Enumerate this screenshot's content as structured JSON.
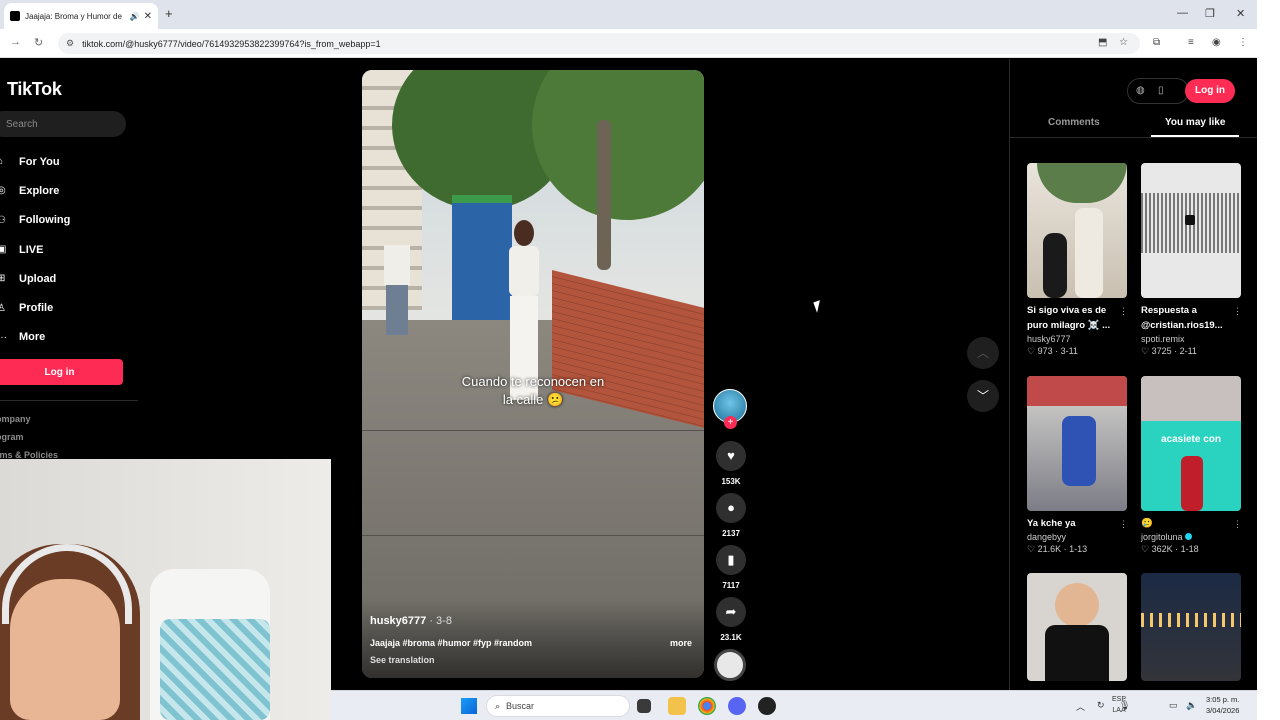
{
  "browser": {
    "tab_title": "Jaajaja: Broma y Humor de",
    "tab_close": "✕",
    "new_tab": "+",
    "url": "tiktok.com/@husky6777/video/7614932953822399764?is_from_webapp=1"
  },
  "sidebar": {
    "logo_text": "TikTok",
    "search_placeholder": "Search",
    "items": [
      {
        "label": "For You",
        "icon": "home-icon"
      },
      {
        "label": "Explore",
        "icon": "compass-icon"
      },
      {
        "label": "Following",
        "icon": "people-icon"
      },
      {
        "label": "LIVE",
        "icon": "live-icon"
      },
      {
        "label": "Upload",
        "icon": "upload-icon"
      },
      {
        "label": "Profile",
        "icon": "person-icon"
      },
      {
        "label": "More",
        "icon": "more-icon"
      }
    ],
    "login_label": "Log in",
    "footer_links": [
      "ompany",
      "ogram",
      "rms & Policies"
    ]
  },
  "video": {
    "caption_line1": "Cuando te reconocen en",
    "caption_line2": "la calle 😕",
    "username": "husky6777",
    "date": " · 3-8",
    "description": "Jaajaja #broma #humor #fyp #random",
    "more_label": "more",
    "see_translation": "See translation"
  },
  "actions": {
    "likes": "153K",
    "comments": "2137",
    "saves": "7117",
    "shares": "23.1K"
  },
  "right_panel": {
    "login_label": "Log in",
    "tab_comments": "Comments",
    "tab_you_may_like": "You may like",
    "cards": [
      {
        "title": "Si sigo viva es de puro milagro ☠️ ...",
        "user": "husky6777",
        "stats": "♡ 973 · 3-11"
      },
      {
        "title": "Respuesta a @cristian.rios19...",
        "user": "spoti.remix",
        "stats": "♡ 3725 · 2-11"
      },
      {
        "title": "Ya kche ya",
        "user": "dangebyy",
        "stats": "♡ 21.6K · 1-13"
      },
      {
        "title": "🥲",
        "user": "jorgitoluna",
        "stats": "♡ 362K · 1-18"
      },
      {
        "title": "",
        "user": "",
        "stats": ""
      },
      {
        "title": "",
        "user": "",
        "stats": ""
      }
    ],
    "thumb_text_acasiete": "acasiete con"
  },
  "taskbar": {
    "search_label": "Buscar",
    "lang_line1": "ESP",
    "lang_line2": "LAA",
    "time": "3:05 p. m.",
    "date": "3/04/2026"
  },
  "colors": {
    "accent": "#fe2c55",
    "page_bg": "#000000",
    "verified": "#20d5ec"
  }
}
